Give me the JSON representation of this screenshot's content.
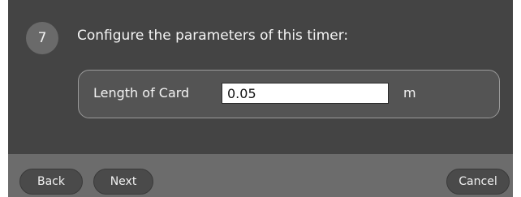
{
  "step": {
    "number": "7",
    "instruction": "Configure the parameters of this timer:"
  },
  "parameter": {
    "label": "Length of Card",
    "value": "0.05",
    "unit": "m"
  },
  "footer": {
    "back_label": "Back",
    "next_label": "Next",
    "cancel_label": "Cancel"
  }
}
